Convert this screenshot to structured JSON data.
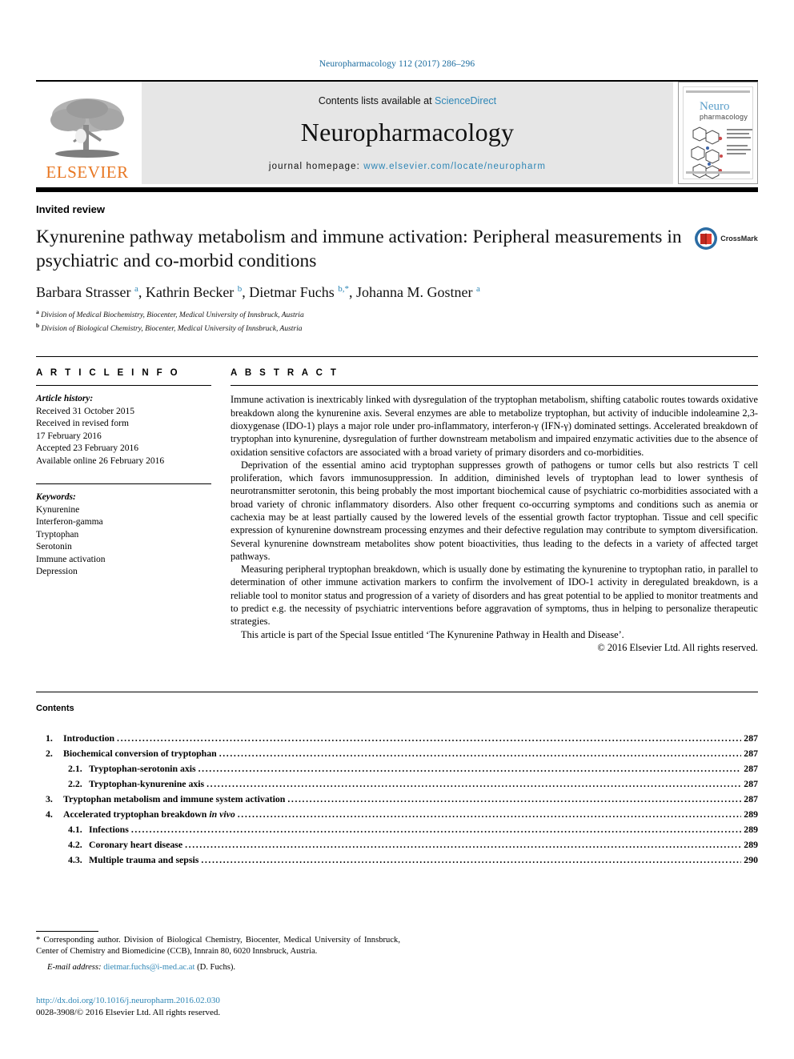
{
  "running_head": "Neuropharmacology 112 (2017) 286–296",
  "journal_header": {
    "publisher_name": "ELSEVIER",
    "contents_prefix": "Contents lists available at ",
    "contents_link": "ScienceDirect",
    "journal_name": "Neuropharmacology",
    "homepage_prefix": "journal homepage: ",
    "homepage_url": "www.elsevier.com/locate/neuropharm",
    "cover_title_line1": "Neuro",
    "cover_title_line2": "pharmacology",
    "link_color": "#2e86b6",
    "publisher_color": "#E87722"
  },
  "article": {
    "type": "Invited review",
    "title": "Kynurenine pathway metabolism and immune activation: Peripheral measurements in psychiatric and co-morbid conditions",
    "crossmark_label": "CrossMark",
    "authors_html": "Barbara Strasser <sup>a</sup>, Kathrin Becker <sup>b</sup>, Dietmar Fuchs <sup>b,&#42;</sup>, Johanna M. Gostner <sup>a</sup>",
    "affiliations": [
      {
        "mark": "a",
        "text": "Division of Medical Biochemistry, Biocenter, Medical University of Innsbruck, Austria"
      },
      {
        "mark": "b",
        "text": "Division of Biological Chemistry, Biocenter, Medical University of Innsbruck, Austria"
      }
    ]
  },
  "article_info": {
    "heading": "A R T I C L E  I N F O",
    "history_label": "Article history:",
    "history_lines": [
      "Received 31 October 2015",
      "Received in revised form",
      "17 February 2016",
      "Accepted 23 February 2016",
      "Available online 26 February 2016"
    ],
    "keywords_label": "Keywords:",
    "keywords": [
      "Kynurenine",
      "Interferon-gamma",
      "Tryptophan",
      "Serotonin",
      "Immune activation",
      "Depression"
    ]
  },
  "abstract": {
    "heading": "A B S T R A C T",
    "paragraphs": [
      "Immune activation is inextricably linked with dysregulation of the tryptophan metabolism, shifting catabolic routes towards oxidative breakdown along the kynurenine axis. Several enzymes are able to metabolize tryptophan, but activity of inducible indoleamine 2,3-dioxygenase (IDO-1) plays a major role under pro-inflammatory, interferon-γ (IFN-γ) dominated settings. Accelerated breakdown of tryptophan into kynurenine, dysregulation of further downstream metabolism and impaired enzymatic activities due to the absence of oxidation sensitive cofactors are associated with a broad variety of primary disorders and co-morbidities.",
      "Deprivation of the essential amino acid tryptophan suppresses growth of pathogens or tumor cells but also restricts T cell proliferation, which favors immunosuppression. In addition, diminished levels of tryptophan lead to lower synthesis of neurotransmitter serotonin, this being probably the most important biochemical cause of psychiatric co-morbidities associated with a broad variety of chronic inflammatory disorders. Also other frequent co-occurring symptoms and conditions such as anemia or cachexia may be at least partially caused by the lowered levels of the essential growth factor tryptophan. Tissue and cell specific expression of kynurenine downstream processing enzymes and their defective regulation may contribute to symptom diversification. Several kynurenine downstream metabolites show potent bioactivities, thus leading to the defects in a variety of affected target pathways.",
      "Measuring peripheral tryptophan breakdown, which is usually done by estimating the kynurenine to tryptophan ratio, in parallel to determination of other immune activation markers to confirm the involvement of IDO-1 activity in deregulated breakdown, is a reliable tool to monitor status and progression of a variety of disorders and has great potential to be applied to monitor treatments and to predict e.g. the necessity of psychiatric interventions before aggravation of symptoms, thus in helping to personalize therapeutic strategies.",
      "This article is part of the Special Issue entitled ‘The Kynurenine Pathway in Health and Disease’."
    ],
    "copyright": "© 2016 Elsevier Ltd. All rights reserved."
  },
  "contents": {
    "heading": "Contents",
    "dots": "................................................................................................................................................................................................",
    "entries": [
      {
        "num": "1.",
        "label": "Introduction",
        "page": "287",
        "sub": false
      },
      {
        "num": "2.",
        "label": "Biochemical conversion of tryptophan",
        "page": "287",
        "sub": false
      },
      {
        "num": "2.1.",
        "label": "Tryptophan-serotonin axis",
        "page": "287",
        "sub": true
      },
      {
        "num": "2.2.",
        "label": "Tryptophan-kynurenine axis",
        "page": "287",
        "sub": true
      },
      {
        "num": "3.",
        "label": "Tryptophan metabolism and immune system activation",
        "page": "287",
        "sub": false
      },
      {
        "num": "4.",
        "label": "Accelerated tryptophan breakdown in vivo",
        "page": "289",
        "sub": false,
        "italic_tail": "in vivo"
      },
      {
        "num": "4.1.",
        "label": "Infections",
        "page": "289",
        "sub": true
      },
      {
        "num": "4.2.",
        "label": "Coronary heart disease",
        "page": "289",
        "sub": true
      },
      {
        "num": "4.3.",
        "label": "Multiple trauma and sepsis",
        "page": "290",
        "sub": true
      }
    ]
  },
  "footnotes": {
    "corresponding": "* Corresponding author. Division of Biological Chemistry, Biocenter, Medical University of Innsbruck, Center of Chemistry and Biomedicine (CCB), Innrain 80, 6020 Innsbruck, Austria.",
    "email_label": "E-mail address:",
    "email_address": "dietmar.fuchs@i-med.ac.at",
    "email_owner": "(D. Fuchs).",
    "doi_url": "http://dx.doi.org/10.1016/j.neuropharm.2016.02.030",
    "issn_line": "0028-3908/© 2016 Elsevier Ltd. All rights reserved."
  }
}
